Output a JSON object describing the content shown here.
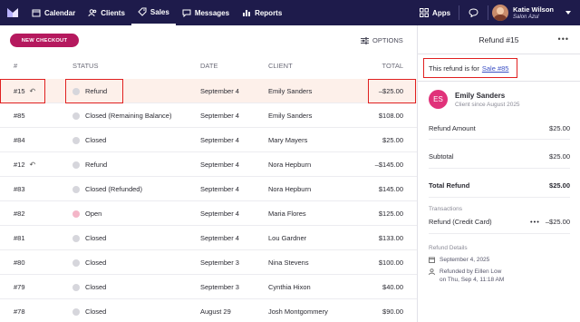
{
  "nav": {
    "items": [
      {
        "label": "Calendar",
        "icon": "calendar-icon"
      },
      {
        "label": "Clients",
        "icon": "clients-icon"
      },
      {
        "label": "Sales",
        "icon": "tag-icon"
      },
      {
        "label": "Messages",
        "icon": "chat-icon"
      },
      {
        "label": "Reports",
        "icon": "bar-chart-icon"
      }
    ],
    "apps_label": "Apps",
    "user_name": "Katie Wilson",
    "user_sub": "Salon Azul"
  },
  "toolbar": {
    "new_checkout": "NEW CHECKOUT",
    "options": "OPTIONS"
  },
  "table": {
    "headers": {
      "num": "#",
      "status": "STATUS",
      "date": "DATE",
      "client": "CLIENT",
      "total": "TOTAL"
    },
    "rows": [
      {
        "num": "#15",
        "refund": true,
        "status": "Refund",
        "date": "September 4",
        "client": "Emily Sanders",
        "total": "–$25.00",
        "dot": "grey"
      },
      {
        "num": "#85",
        "refund": false,
        "status": "Closed (Remaining Balance)",
        "date": "September 4",
        "client": "Emily Sanders",
        "total": "$108.00",
        "dot": "grey"
      },
      {
        "num": "#84",
        "refund": false,
        "status": "Closed",
        "date": "September 4",
        "client": "Mary Mayers",
        "total": "$25.00",
        "dot": "grey"
      },
      {
        "num": "#12",
        "refund": true,
        "status": "Refund",
        "date": "September 4",
        "client": "Nora Hepburn",
        "total": "–$145.00",
        "dot": "grey"
      },
      {
        "num": "#83",
        "refund": false,
        "status": "Closed (Refunded)",
        "date": "September 4",
        "client": "Nora Hepburn",
        "total": "$145.00",
        "dot": "grey"
      },
      {
        "num": "#82",
        "refund": false,
        "status": "Open",
        "date": "September 4",
        "client": "Maria Flores",
        "total": "$125.00",
        "dot": "pink"
      },
      {
        "num": "#81",
        "refund": false,
        "status": "Closed",
        "date": "September 4",
        "client": "Lou Gardner",
        "total": "$133.00",
        "dot": "grey"
      },
      {
        "num": "#80",
        "refund": false,
        "status": "Closed",
        "date": "September 3",
        "client": "Nina Stevens",
        "total": "$100.00",
        "dot": "grey"
      },
      {
        "num": "#79",
        "refund": false,
        "status": "Closed",
        "date": "September 3",
        "client": "Cynthia Hixon",
        "total": "$40.00",
        "dot": "grey"
      },
      {
        "num": "#78",
        "refund": false,
        "status": "Closed",
        "date": "August 29",
        "client": "Josh Montgommery",
        "total": "$90.00",
        "dot": "grey"
      }
    ]
  },
  "panel": {
    "title": "Refund #15",
    "for_text": "This refund is for",
    "for_link": "Sale #85",
    "client_initials": "ES",
    "client_name": "Emily Sanders",
    "client_since": "Client since August 2025",
    "refund_amount_label": "Refund Amount",
    "refund_amount": "$25.00",
    "subtotal_label": "Subtotal",
    "subtotal": "$25.00",
    "total_label": "Total Refund",
    "total": "$25.00",
    "transactions_label": "Transactions",
    "transaction_label": "Refund (Credit Card)",
    "transaction_amount": "–$25.00",
    "details_label": "Refund Details",
    "detail_date": "September 4, 2025",
    "detail_by": "Refunded by Eillen Low",
    "detail_when": "on Thu, Sep 4, 11:18 AM"
  },
  "colors": {
    "nav_bg": "#1e1b4b",
    "accent": "#b5195e",
    "link": "#3b4fc4",
    "highlight_box": "#e02020"
  }
}
